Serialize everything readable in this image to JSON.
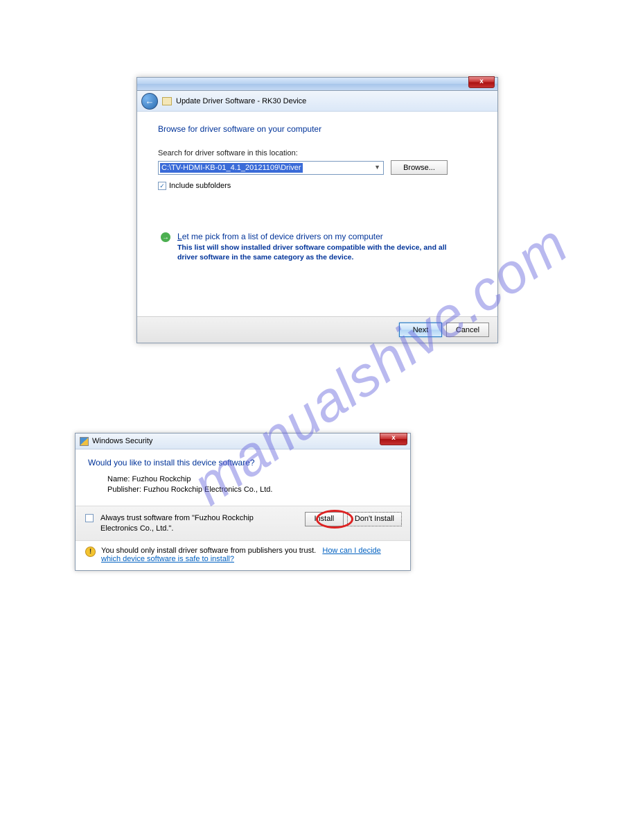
{
  "watermark": "manualshive.com",
  "dialog1": {
    "title": "Update Driver Software - RK30 Device",
    "close_x": "x",
    "heading": "Browse for driver software on your computer",
    "search_label": "Search for driver software in this location:",
    "path_value": "C:\\TV-HDMI-KB-01_4.1_20121109\\Driver",
    "browse_label": "Browse...",
    "include_subfolders": "Include subfolders",
    "pick_title_prefix": "L",
    "pick_title_rest": "et me pick from a list of device drivers on my computer",
    "pick_desc": "This list will show installed driver software compatible with the device, and all driver software in the same category as the device.",
    "next_label": "Next",
    "cancel_label": "Cancel"
  },
  "dialog2": {
    "title": "Windows Security",
    "close_x": "x",
    "heading": "Would you like to install this device software?",
    "name_label": "Name: Fuzhou Rockchip",
    "publisher_label": "Publisher: Fuzhou Rockchip Electronics Co., Ltd.",
    "trust_text": "Always trust software from \"Fuzhou Rockchip Electronics Co., Ltd.\".",
    "install_label": "Install",
    "dont_install_label": "Don't Install",
    "warn_text": "You should only install driver software from publishers you trust.",
    "warn_link": "How can I decide which device software is safe to install?"
  }
}
